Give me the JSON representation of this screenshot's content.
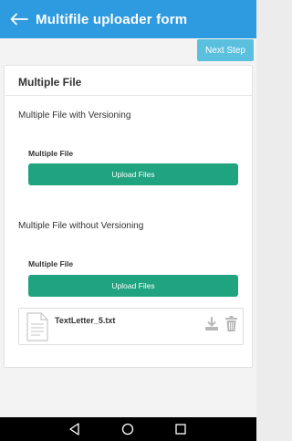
{
  "appbar": {
    "title": "Multifile uploader form",
    "back_icon": "arrow-left-icon"
  },
  "toolbar": {
    "next_step_label": "Next Step"
  },
  "card": {
    "title": "Multiple File",
    "versioned": {
      "section_label": "Multiple File with Versioning",
      "field_label": "Multiple File",
      "upload_label": "Upload Files"
    },
    "unversioned": {
      "section_label": "Multiple File without Versioning",
      "field_label": "Multiple File",
      "upload_label": "Upload Files"
    },
    "files": [
      {
        "name": "TextLetter_5.txt",
        "icon": "document-icon"
      }
    ]
  },
  "colors": {
    "appbar": "#2e9be0",
    "next_button": "#5bc0de",
    "upload_button": "#20a37f",
    "navbar": "#000000"
  },
  "system_nav": {
    "back_icon": "triangle-back-icon",
    "home_icon": "circle-home-icon",
    "recent_icon": "square-recent-icon"
  }
}
